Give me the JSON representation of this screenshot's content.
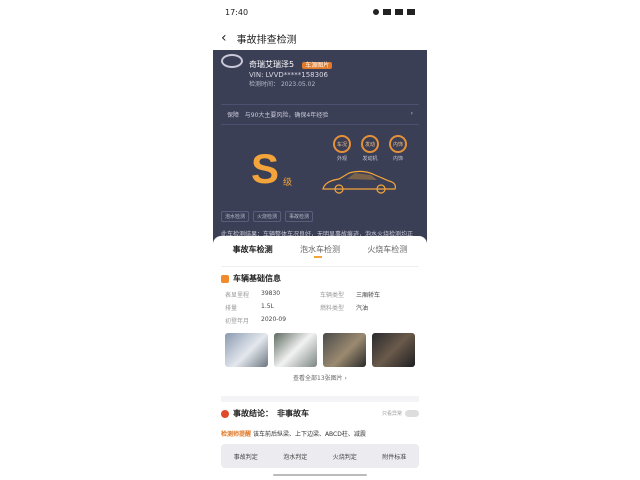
{
  "status": {
    "time": "17:40"
  },
  "nav": {
    "title": "事故排查检测"
  },
  "car": {
    "name": "奇瑞艾瑞泽5",
    "badge": "车源图片",
    "vin": "VIN: LVVD*****158306",
    "date_label": "检测时间：",
    "date": "2023.05.02"
  },
  "guarantee": {
    "label": "保障",
    "text": "与90大主要风险，确保4年经验",
    "arrow": "›"
  },
  "grade": {
    "letter": "S",
    "suffix": "级"
  },
  "rings": [
    {
      "value": "车况",
      "label": "外观"
    },
    {
      "value": "发动",
      "label": "发动机"
    },
    {
      "value": "内饰",
      "label": "内饰"
    }
  ],
  "chips": [
    "泡水检测",
    "火烧检测",
    "事故检测"
  ],
  "description": "此车检测结果：车辆整体车况良好，无明显事故痕迹，泡水火烧检测均正常，建议放心购买。",
  "tabs": [
    {
      "label": "事故车检测",
      "active": true
    },
    {
      "label": "泡水车检测",
      "active": false
    },
    {
      "label": "火烧车检测",
      "active": false
    }
  ],
  "basic_info": {
    "title": "车辆基础信息",
    "rows": [
      {
        "label": "表显里程",
        "value": "39830"
      },
      {
        "label": "车辆类型",
        "value": "三厢轿车"
      },
      {
        "label": "排量",
        "value": "1.5L"
      },
      {
        "label": "燃料类型",
        "value": "汽油"
      },
      {
        "label": "初登年月",
        "value": "2020-09"
      }
    ],
    "view_all": "查看全部13张图片 ›"
  },
  "conclusion": {
    "label": "事故结论：",
    "value": "非事故车",
    "toggle_label": "只看异常"
  },
  "summary": {
    "brand": "检测师提醒",
    "text": "该车前后纵梁、上下边梁、ABCD柱、减震"
  },
  "bottom_nav": [
    "事故判定",
    "泡水判定",
    "火烧判定",
    "附件标准"
  ],
  "colors": {
    "accent": "#f3a43a",
    "dark_panel": "#3b3f55"
  }
}
